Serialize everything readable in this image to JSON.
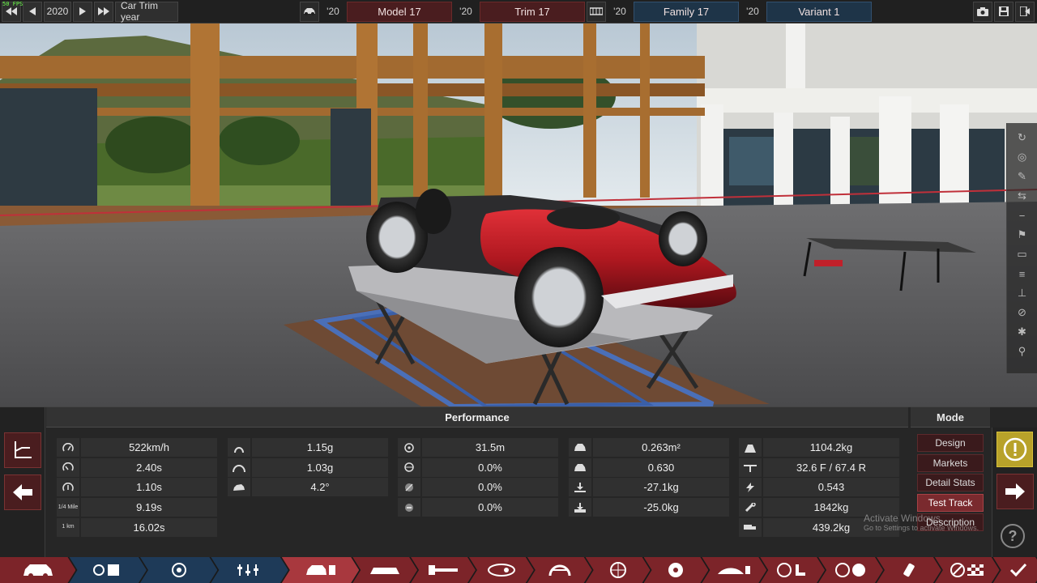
{
  "fps": "50 FPS",
  "topbar": {
    "year": "2020",
    "trim_label": "Car Trim year",
    "model_year": "'20",
    "model_name": "Model 17",
    "trim_year": "'20",
    "trim_name": "Trim 17",
    "family_year": "'20",
    "family_name": "Family 17",
    "variant_year": "'20",
    "variant_name": "Variant 1"
  },
  "panel": {
    "performance_title": "Performance",
    "mode_title": "Mode",
    "stats": {
      "col1": [
        "522km/h",
        "2.40s",
        "1.10s",
        "9.19s",
        "16.02s"
      ],
      "col1_icon_text": [
        "",
        "",
        "",
        "1/4 Mile",
        "1 km"
      ],
      "col2": [
        "1.15g",
        "1.03g",
        "4.2°"
      ],
      "col3": [
        "31.5m",
        "0.0%",
        "0.0%",
        "0.0%"
      ],
      "col4": [
        "0.263m²",
        "0.630",
        "-27.1kg",
        "-25.0kg"
      ],
      "col5": [
        "1104.2kg",
        "32.6 F / 67.4 R",
        "0.543",
        "1842kg",
        "439.2kg"
      ]
    },
    "mode_buttons": [
      "Design",
      "Markets",
      "Detail Stats",
      "Test Track",
      "Description"
    ],
    "active_mode": "Test Track",
    "watermark_title": "Activate Windows",
    "watermark_sub": "Go to Settings to activate Windows."
  },
  "icons": {
    "prev_year": "skip-back-icon",
    "back": "triangle-left-icon",
    "forward": "triangle-right-icon",
    "next_year": "skip-forward-icon",
    "car": "car-icon",
    "menu": "menu-icon",
    "camera": "camera-icon",
    "save": "save-icon"
  },
  "colors": {
    "accent_red": "#7c2429",
    "accent_blue": "#1e3a58",
    "warn_yellow": "#b8a22a",
    "car_body_red": "#b01820"
  }
}
